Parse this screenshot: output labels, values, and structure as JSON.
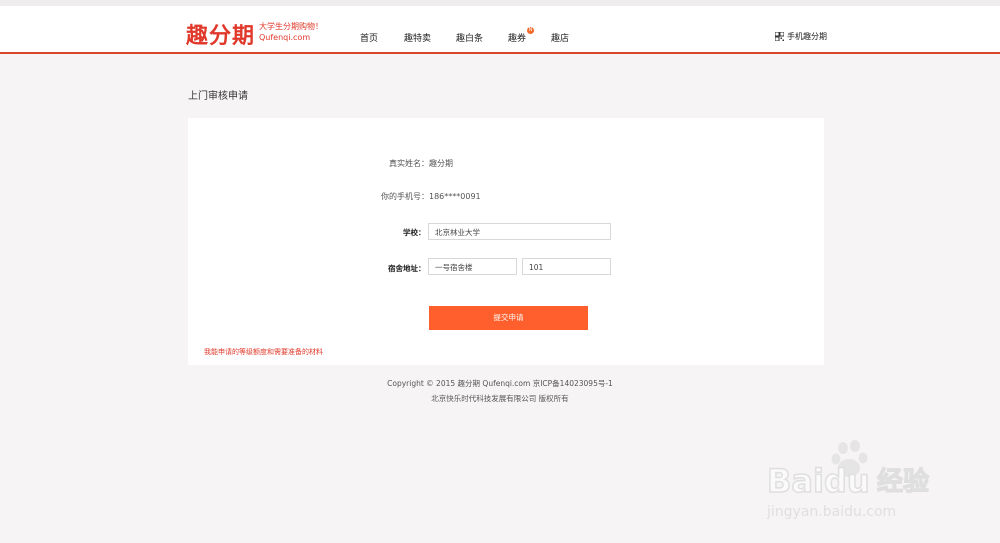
{
  "header": {
    "logo": "趣分期",
    "slogan_line1": "大学生分期购物！",
    "slogan_line2": "Qufenqi.com",
    "nav": [
      {
        "label": "首页"
      },
      {
        "label": "趣特卖"
      },
      {
        "label": "趣白条"
      },
      {
        "label": "趣券",
        "badge": "N"
      },
      {
        "label": "趣店"
      }
    ],
    "mobile_label": "手机趣分期"
  },
  "page": {
    "title": "上门审核申请"
  },
  "form": {
    "name_label": "真实姓名：",
    "name_value": "趣分期",
    "phone_label": "你的手机号：",
    "phone_value": "186****0091",
    "school_label": "学校：",
    "school_value": "北京林业大学",
    "dorm_label": "宿舍地址：",
    "dorm_building": "一号宿舍楼",
    "dorm_room": "101",
    "submit_label": "提交申请",
    "help_link": "我能申请的等级额度和需要准备的材料"
  },
  "footer": {
    "line1": "Copyright © 2015 趣分期 Qufenqi.com 京ICP备14023095号-1",
    "line2": "北京快乐时代科技发展有限公司 版权所有"
  },
  "watermark": {
    "brand": "Baidu",
    "brand_cn": "经验",
    "url": "jingyan.baidu.com"
  },
  "colors": {
    "accent": "#e0392b",
    "button": "#ff5f2c",
    "background": "#f6f4f5"
  }
}
